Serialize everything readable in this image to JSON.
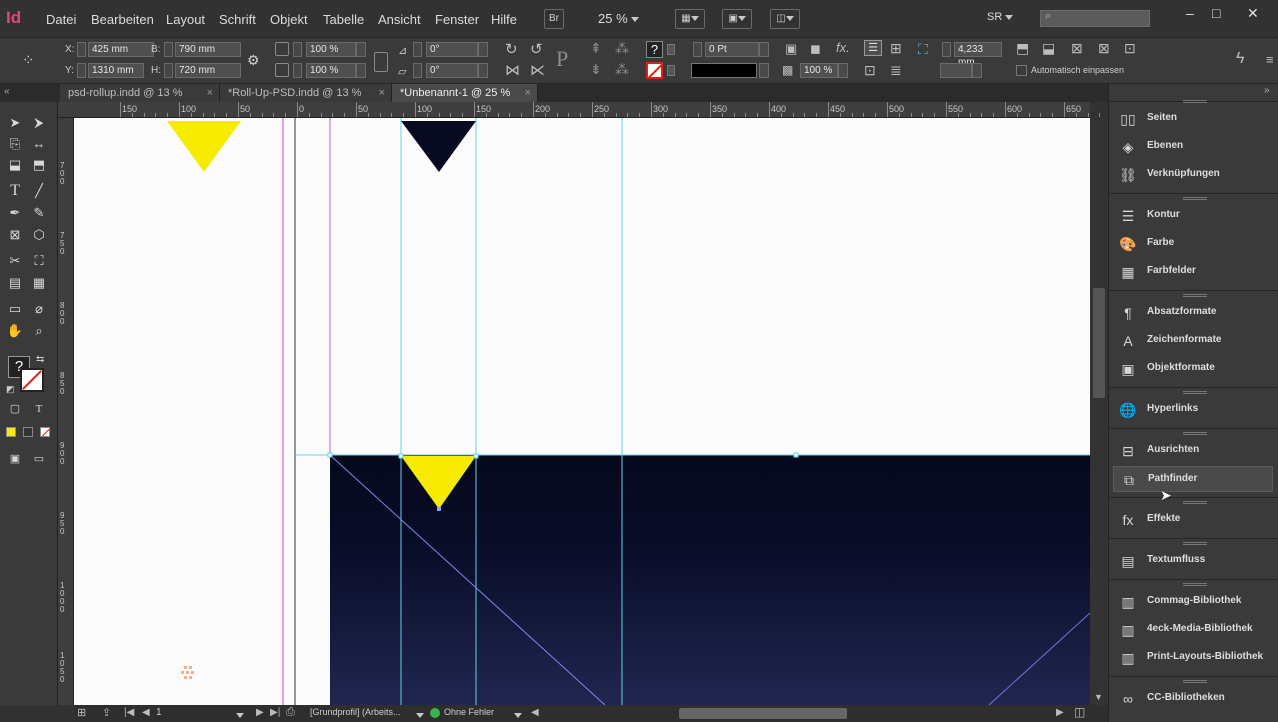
{
  "app": {
    "logo": "Id"
  },
  "menubar": {
    "items": [
      "Datei",
      "Bearbeiten",
      "Layout",
      "Schrift",
      "Objekt",
      "Tabelle",
      "Ansicht",
      "Fenster",
      "Hilfe"
    ],
    "bridge_label": "Br",
    "zoom": "25 %",
    "workspace": "SR"
  },
  "control": {
    "x_label": "X:",
    "x_value": "425 mm",
    "y_label": "Y:",
    "y_value": "1310 mm",
    "b_label": "B:",
    "b_value": "790 mm",
    "h_label": "H:",
    "h_value": "720 mm",
    "scale_x": "100 %",
    "scale_y": "100 %",
    "rotate": "0°",
    "shear": "0°",
    "stroke_weight": "0 Pt",
    "opacity": "100 %",
    "frame_value": "4,233 mm",
    "autofit_label": "Automatisch einpassen"
  },
  "tabs": [
    {
      "label": "psd-rollup.indd @ 13 %",
      "active": false
    },
    {
      "label": "*Roll-Up-PSD.indd @ 13 %",
      "active": false
    },
    {
      "label": "*Unbenannt-1 @ 25 %",
      "active": true
    }
  ],
  "ruler": {
    "h_ticks": [
      "150",
      "100",
      "50",
      "0",
      "50",
      "100",
      "150",
      "200",
      "250",
      "300",
      "350",
      "400",
      "450",
      "500",
      "550",
      "600",
      "650"
    ],
    "v_ticks": [
      "7\n0\n0",
      "7\n5\n0",
      "8\n0\n0",
      "8\n5\n0",
      "9\n0\n0",
      "9\n5\n0",
      "1\n0\n0\n0",
      "1\n0\n5\n0"
    ]
  },
  "panels": [
    {
      "label": "Seiten",
      "icon": "pages-icon",
      "glyph": "▯▯"
    },
    {
      "label": "Ebenen",
      "icon": "layers-icon",
      "glyph": "◈"
    },
    {
      "label": "Verknüpfungen",
      "icon": "links-icon",
      "glyph": "⛓"
    },
    {
      "label": "Kontur",
      "icon": "stroke-icon",
      "glyph": "☰"
    },
    {
      "label": "Farbe",
      "icon": "color-icon",
      "glyph": "🎨"
    },
    {
      "label": "Farbfelder",
      "icon": "swatches-icon",
      "glyph": "▦"
    },
    {
      "label": "Absatzformate",
      "icon": "paragraph-styles-icon",
      "glyph": "¶"
    },
    {
      "label": "Zeichenformate",
      "icon": "character-styles-icon",
      "glyph": "A"
    },
    {
      "label": "Objektformate",
      "icon": "object-styles-icon",
      "glyph": "▣"
    },
    {
      "label": "Hyperlinks",
      "icon": "hyperlinks-icon",
      "glyph": "🌐"
    },
    {
      "label": "Ausrichten",
      "icon": "align-icon",
      "glyph": "⊟"
    },
    {
      "label": "Pathfinder",
      "icon": "pathfinder-icon",
      "glyph": "⧉"
    },
    {
      "label": "Effekte",
      "icon": "effects-icon",
      "glyph": "fx"
    },
    {
      "label": "Textumfluss",
      "icon": "text-wrap-icon",
      "glyph": "▤"
    },
    {
      "label": "Commag-Bibliothek",
      "icon": "library-icon",
      "glyph": "▥"
    },
    {
      "label": "4eck-Media-Bibliothek",
      "icon": "library-icon",
      "glyph": "▥"
    },
    {
      "label": "Print-Layouts-Bibliothek",
      "icon": "library-icon",
      "glyph": "▥"
    },
    {
      "label": "CC-Bibliotheken",
      "icon": "cc-libraries-icon",
      "glyph": "∞"
    }
  ],
  "status": {
    "page": "1",
    "profile": "[Grundprofil] (Arbeits...",
    "preflight": "Ohne Fehler"
  },
  "colors": {
    "accent_yellow": "#f7ec00",
    "navy": "#0a0d2a",
    "guide_cyan": "#5fd3ea",
    "margin_magenta": "#b04db0"
  }
}
